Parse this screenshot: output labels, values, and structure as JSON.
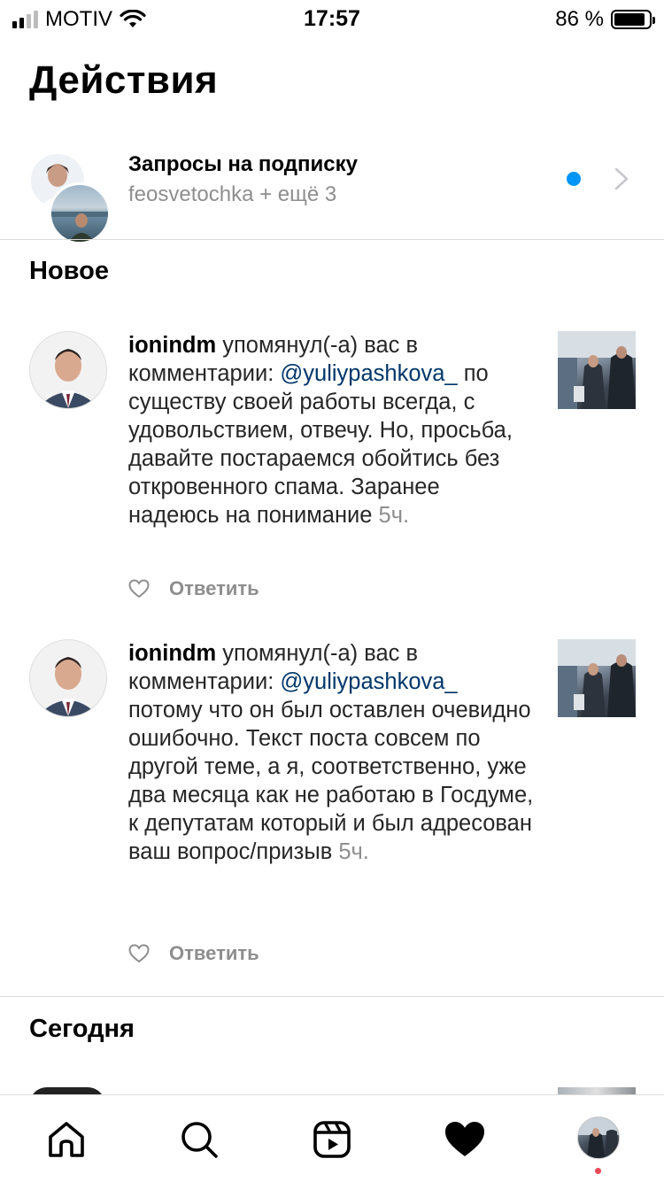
{
  "status_bar": {
    "carrier": "MOTIV",
    "time": "17:57",
    "battery": "86 %"
  },
  "page": {
    "title": "Действия"
  },
  "follow_requests": {
    "title": "Запросы на подписку",
    "subtitle": "feosvetochka + ещё 3",
    "unread_dot_color": "#0095f6"
  },
  "sections": {
    "new": "Новое",
    "today": "Сегодня"
  },
  "notifications": [
    {
      "username": "ionindm",
      "action": " упомянул(-а) вас в комментарии: ",
      "mention": "@yuliypashkova_",
      "comment": " по существу своей работы всегда, с удовольствием, отвечу. Но, просьба, давайте постараемся обойтись без откровенного спама. Заранее надеюсь на понимание",
      "time": " 5ч.",
      "reply_label": "Ответить"
    },
    {
      "username": "ionindm",
      "action": " упомянул(-а) вас в комментарии: ",
      "mention": "@yuliypashkova_",
      "comment": " потому что он был оставлен очевидно ошибочно. Текст поста совсем по другой теме, а я, соответственно, уже два месяца как не работаю в Госдуме, к депутатам который и был адресован ваш вопрос/призыв",
      "time": " 5ч.",
      "reply_label": "Ответить"
    }
  ],
  "tab_bar": {
    "items": [
      "home-icon",
      "search-icon",
      "reels-icon",
      "heart-icon",
      "profile-avatar"
    ],
    "active": "heart-icon",
    "notification_dot_color": "#ed4956"
  }
}
